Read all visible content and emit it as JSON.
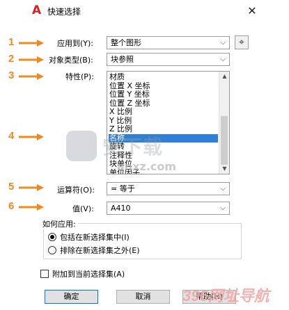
{
  "window": {
    "title": "快速选择",
    "close_glyph": "✕",
    "logo_glyph": "A"
  },
  "annotations": [
    "1",
    "2",
    "3",
    "4",
    "5",
    "6"
  ],
  "fields": {
    "apply_to_label": "应用到(Y):",
    "apply_to_value": "整个图形",
    "object_type_label": "对象类型(B):",
    "object_type_value": "块参照",
    "properties_label": "特性(P):",
    "operator_label": "运算符(O):",
    "operator_value": "= 等于",
    "value_label": "值(V):",
    "value_value": "A410"
  },
  "properties_list": [
    "材质",
    "位置 X 坐标",
    "位置 Y 坐标",
    "位置 Z 坐标",
    "X 比例",
    "Y 比例",
    "Z 比例",
    "名称",
    "旋转",
    "注释性",
    "块单位",
    "单位因子"
  ],
  "properties_selected_index": 7,
  "how_to_apply": {
    "title": "如何应用:",
    "include_label": "包括在新选择集中(I)",
    "exclude_label": "排除在新选择集之外(E)",
    "include_checked": true
  },
  "append_label": "附加到当前选择集(A)",
  "buttons": {
    "ok": "确定",
    "cancel": "取消",
    "help": "帮助(H)"
  },
  "watermark": {
    "text": "安下载",
    "sub": "anxz.com",
    "bottom": "396网址导航"
  },
  "colors": {
    "annotation": "#f08a1c",
    "selection": "#2f7fd6",
    "logo": "#d62020"
  }
}
